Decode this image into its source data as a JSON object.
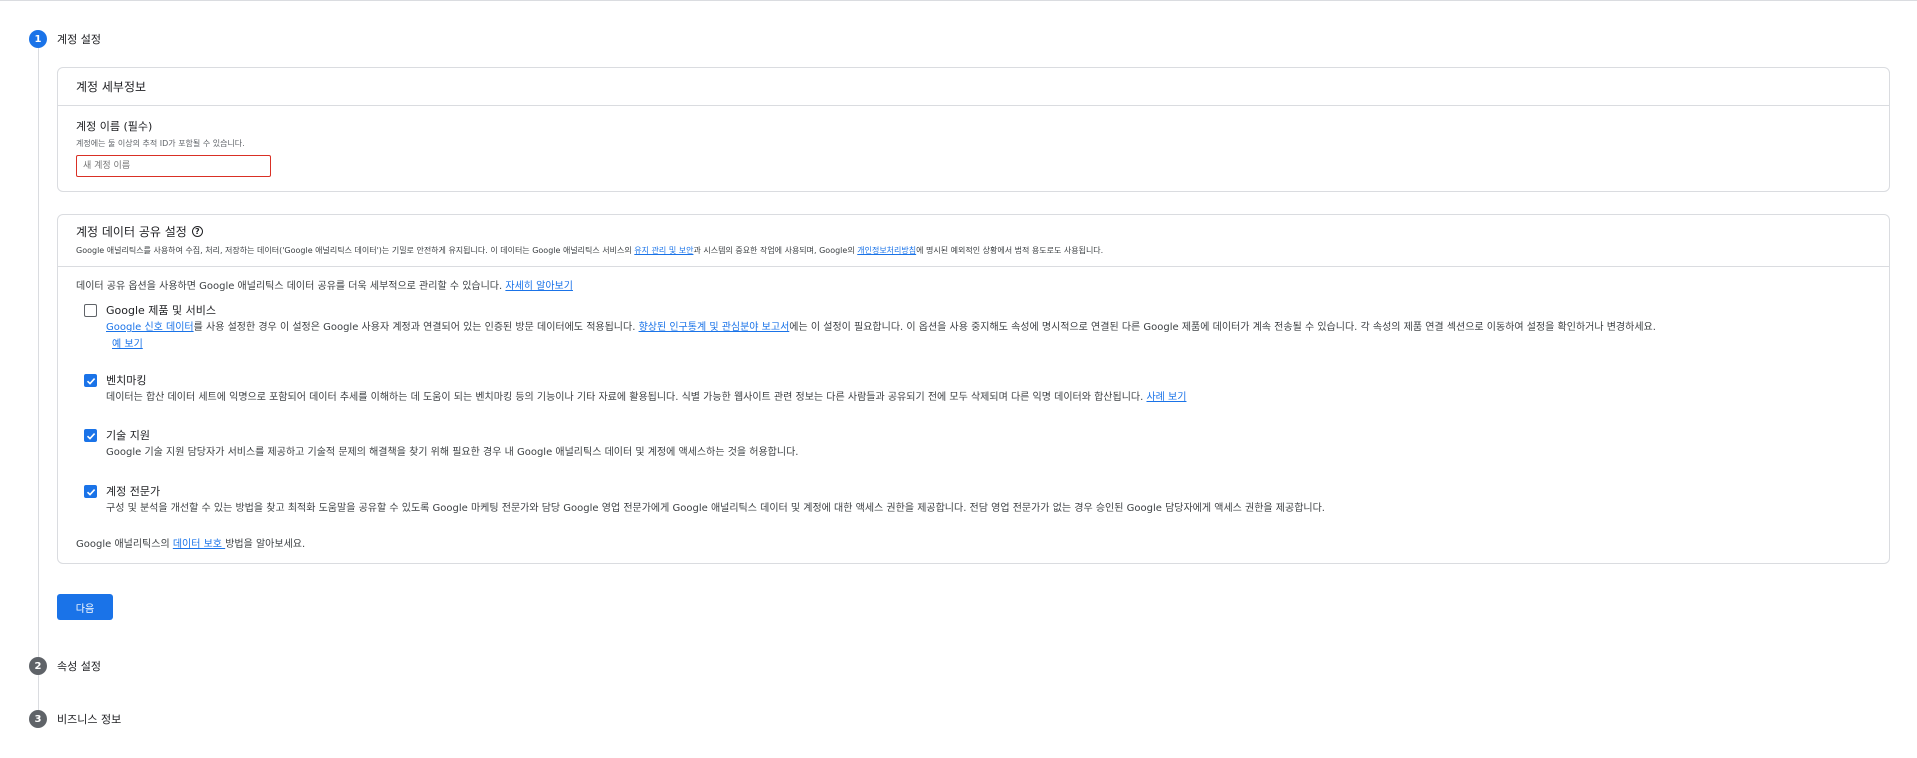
{
  "steps": [
    {
      "number": "1",
      "label": "계정 설정"
    },
    {
      "number": "2",
      "label": "속성 설정"
    },
    {
      "number": "3",
      "label": "비즈니스 정보"
    }
  ],
  "account_details": {
    "title": "계정 세부정보",
    "name_label": "계정 이름 (필수)",
    "name_hint": "계정에는 둘 이상의 추적 ID가 포함될 수 있습니다.",
    "name_placeholder": "새 계정 이름"
  },
  "data_sharing": {
    "title": "계정 데이터 공유 설정",
    "description_pre": "Google 애널리틱스를 사용하여 수집, 처리, 저장하는 데이터('Google 애널리틱스 데이터')는 기밀로 안전하게 유지됩니다. 이 데이터는 Google 애널리틱스 서비스의 ",
    "description_link1": "유지 관리 및 보안",
    "description_mid": "과 시스템의 중요한 작업에 사용되며, Google의 ",
    "description_link2": "개인정보처리방침",
    "description_post": "에 명시된 예외적인 상황에서 법적 용도로도 사용됩니다.",
    "intro_text": "데이터 공유 옵션을 사용하면 Google 애널리틱스 데이터 공유를 더욱 세부적으로 관리할 수 있습니다. ",
    "intro_link": "자세히 알아보기",
    "options": [
      {
        "title": "Google 제품 및 서비스",
        "checked": false,
        "desc_link1": "Google 신호 데이터",
        "desc_mid": "를 사용 설정한 경우 이 설정은 Google 사용자 계정과 연결되어 있는 인증된 방문 데이터에도 적용됩니다. ",
        "desc_link2": "향상된 인구통계 및 관심분야 보고서",
        "desc_post": "에는 이 설정이 필요합니다. 이 옵션을 사용 중지해도 속성에 명시적으로 연결된 다른 Google 제품에 데이터가 계속 전송될 수 있습니다. 각 속성의 제품 연결 섹션으로 이동하여 설정을 확인하거나 변경하세요.",
        "extra_link": "예 보기"
      },
      {
        "title": "벤치마킹",
        "checked": true,
        "desc": "데이터는 합산 데이터 세트에 익명으로 포함되어 데이터 추세를 이해하는 데 도움이 되는 벤치마킹 등의 기능이나 기타 자료에 활용됩니다. 식별 가능한 웹사이트 관련 정보는 다른 사람들과 공유되기 전에 모두 삭제되며 다른 익명 데이터와 합산됩니다. ",
        "extra_link": "사례 보기"
      },
      {
        "title": "기술 지원",
        "checked": true,
        "desc": "Google 기술 지원 담당자가 서비스를 제공하고 기술적 문제의 해결책을 찾기 위해 필요한 경우 내 Google 애널리틱스 데이터 및 계정에 액세스하는 것을 허용합니다."
      },
      {
        "title": "계정 전문가",
        "checked": true,
        "desc": "구성 및 분석을 개선할 수 있는 방법을 찾고 최적화 도움말을 공유할 수 있도록 Google 마케팅 전문가와 담당 Google 영업 전문가에게 Google 애널리틱스 데이터 및 계정에 대한 액세스 권한을 제공합니다. 전담 영업 전문가가 없는 경우 승인된 Google 담당자에게 액세스 권한을 제공합니다."
      }
    ],
    "protection_pre": "Google 애널리틱스의 ",
    "protection_link": "데이터 보호 ",
    "protection_post": "방법을 알아보세요."
  },
  "next_button": "다음",
  "colors": {
    "primary": "#1a73e8",
    "error": "#d93025",
    "border": "#dadce0",
    "inactive_step": "#5f6368"
  },
  "icons": {
    "help": "help-circle-icon",
    "check": "check-icon"
  }
}
